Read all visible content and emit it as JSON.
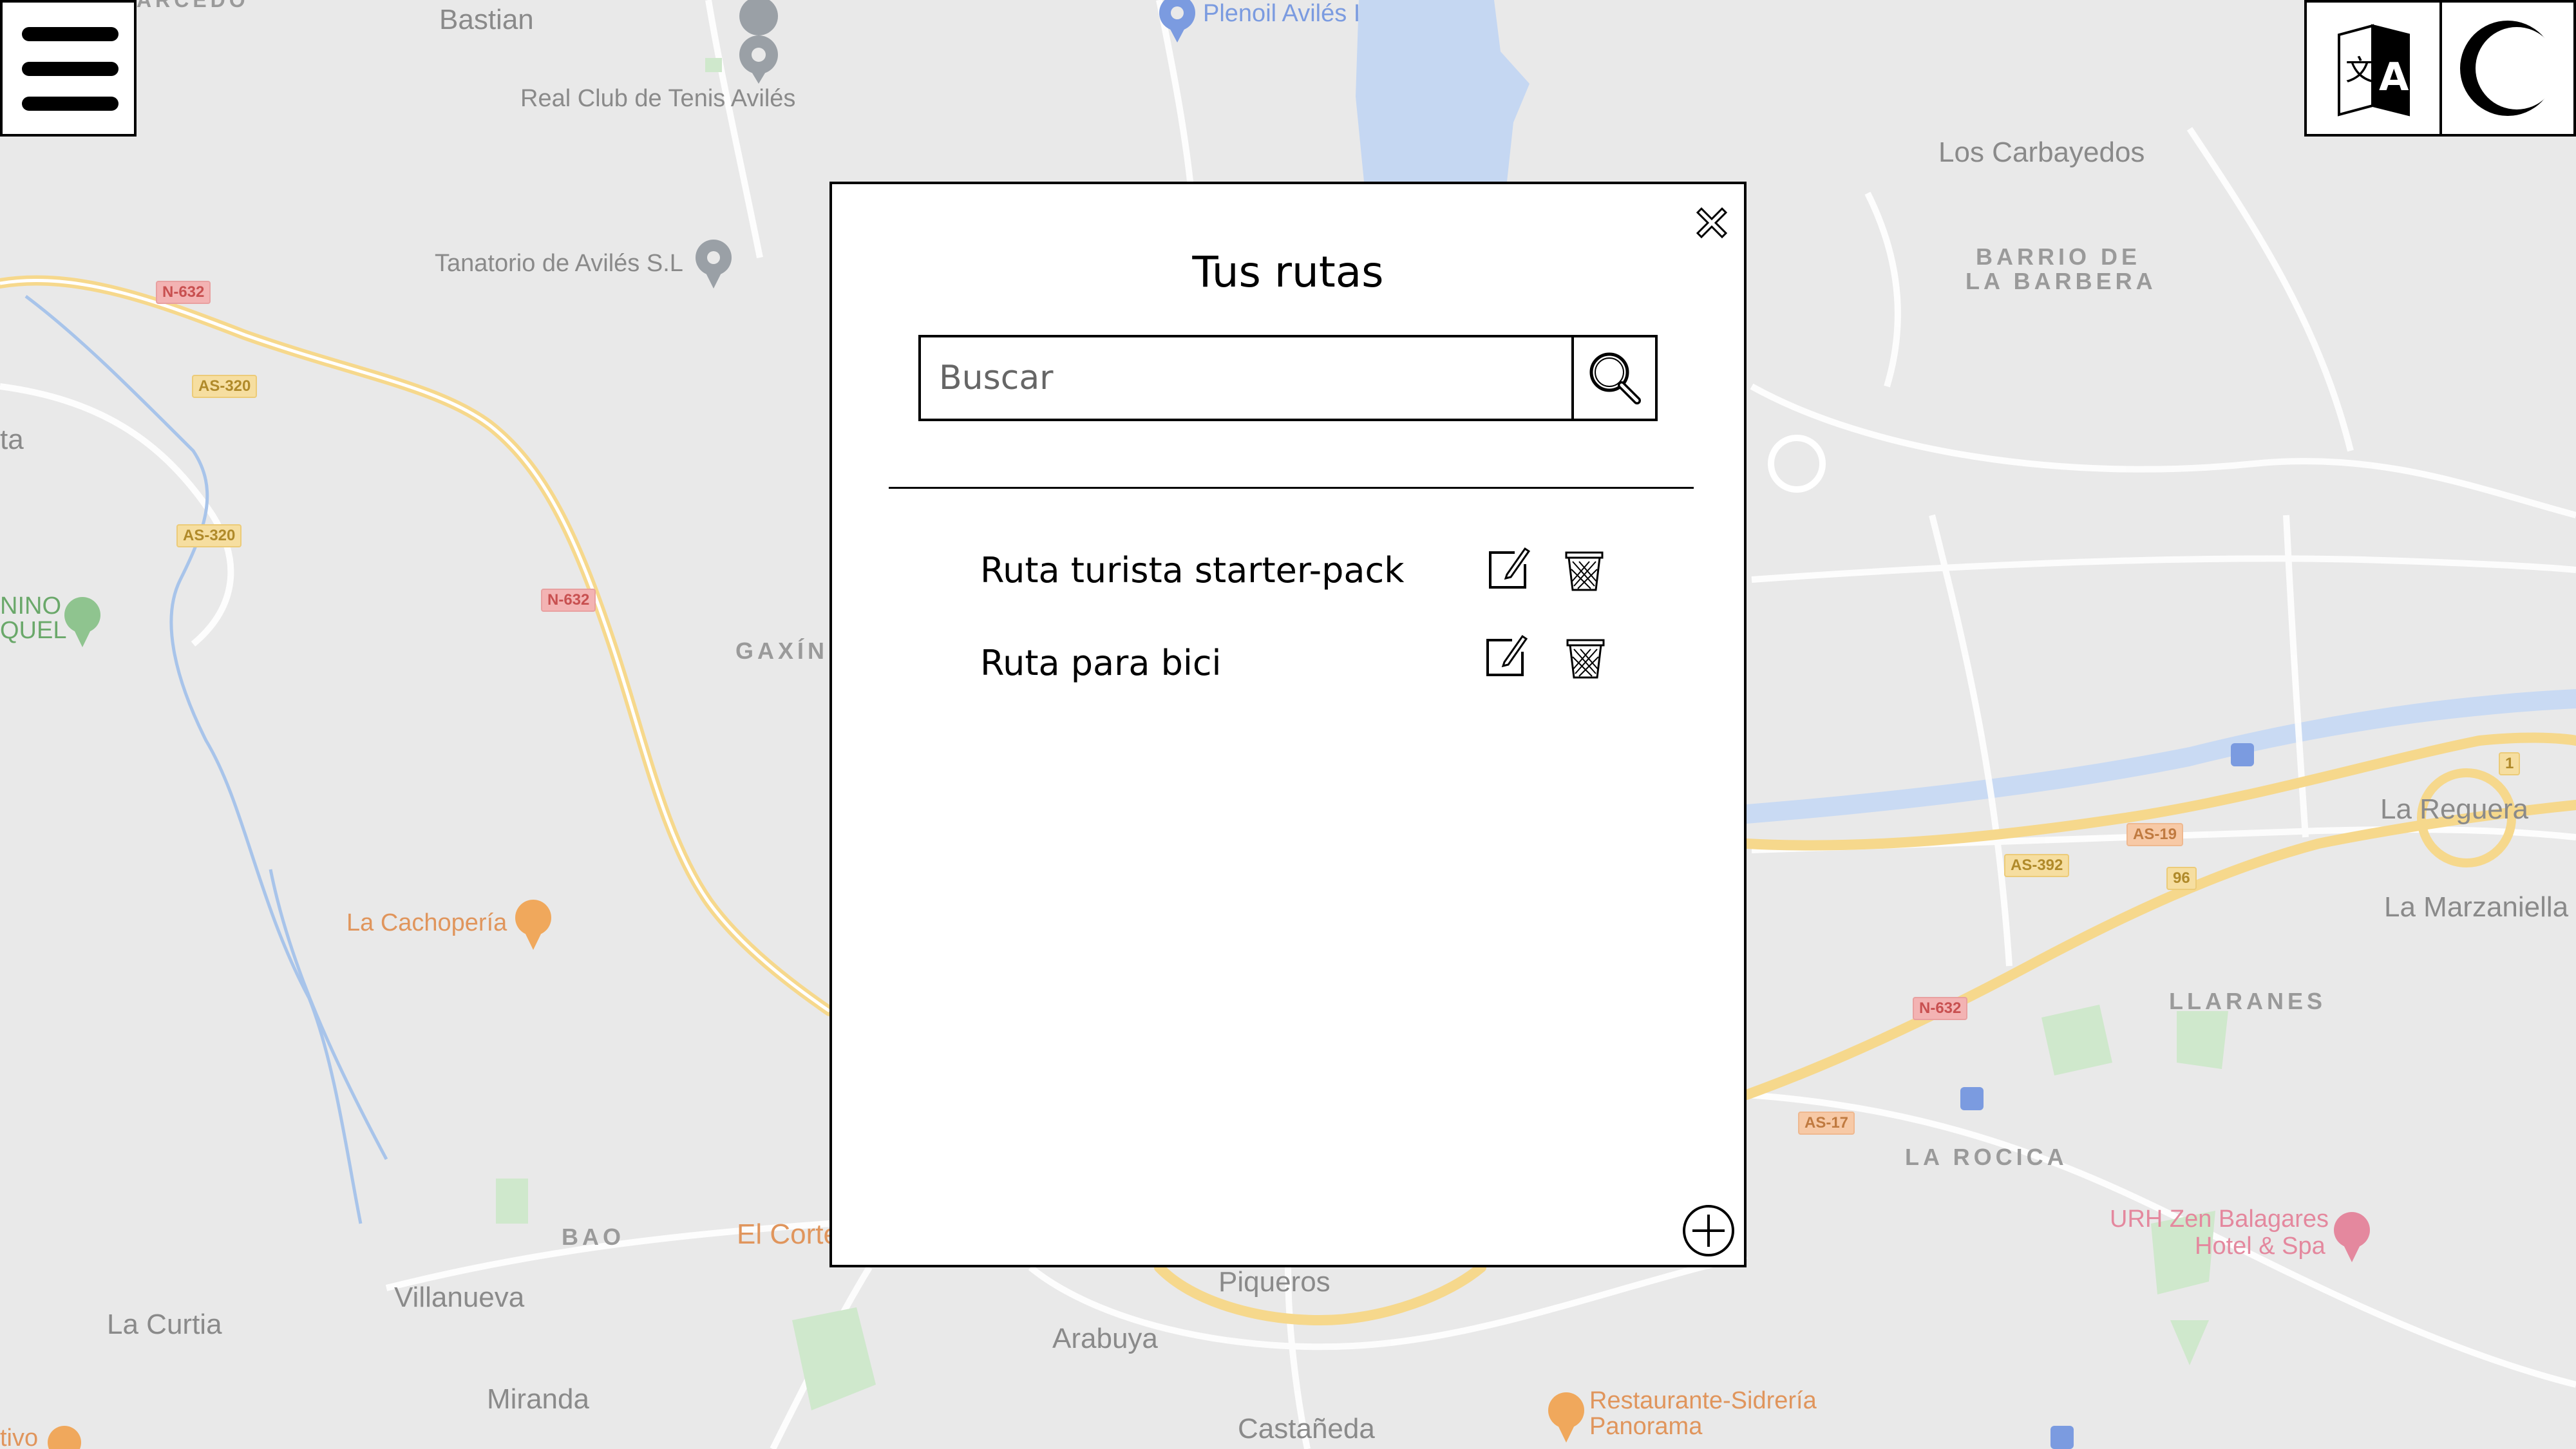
{
  "map": {
    "labels": {
      "bastian": "Bastian",
      "real_club": "Real Club de Tenis Avilés",
      "plenoil": "Plenoil Avilés I",
      "tanatorio": "Tanatorio de Avilés S.L",
      "los_carbayedos": "Los Carbayedos",
      "barrio_1": "BARRIO DE",
      "barrio_2": "LA BARBERA",
      "gaxin": "GAXÍN",
      "la_cachoperia": "La Cachopería",
      "la_reguera": "La Reguera",
      "la_marzaniella": "La Marzaniella",
      "llaranes": "LLARANES",
      "la_rocica": "LA ROCICA",
      "urh_1": "URH Zen Balagares",
      "urh_2": "Hotel & Spa",
      "bao": "BAO",
      "el_corte": "El Corte",
      "villanueva": "Villanueva",
      "la_curtia": "La Curtia",
      "piqueros": "Piqueros",
      "arabuya": "Arabuya",
      "miranda": "Miranda",
      "castaneda": "Castañeda",
      "restaurante_1": "Restaurante-Sidrería",
      "restaurante_2": "Panorama",
      "ninos_1": "NINO",
      "ninos_2": "QUEL",
      "arcedo": "ARCEDO",
      "ta": "ta",
      "tivo": "tivo"
    },
    "shields": {
      "n632_a": "N-632",
      "as320_a": "AS-320",
      "as320_b": "AS-320",
      "n632_b": "N-632",
      "n632_c": "N-632",
      "as19": "AS-19",
      "as392": "AS-392",
      "as17": "AS-17",
      "s96": "96",
      "s1": "1"
    }
  },
  "dialog": {
    "title": "Tus rutas",
    "search_placeholder": "Buscar",
    "routes": [
      {
        "name": "Ruta turista starter-pack"
      },
      {
        "name": "Ruta para bici"
      }
    ]
  },
  "icons": {
    "menu": "hamburger-menu-icon",
    "language": "translate-icon",
    "theme": "dark-mode-icon",
    "close": "close-icon",
    "search": "search-icon",
    "edit": "edit-icon",
    "delete": "trash-icon",
    "add": "add-icon"
  },
  "colors": {
    "map_bg": "#e9e9e9",
    "water": "#c5d7f2",
    "highway": "#f6d88c",
    "dialog_bg": "#ffffff"
  }
}
